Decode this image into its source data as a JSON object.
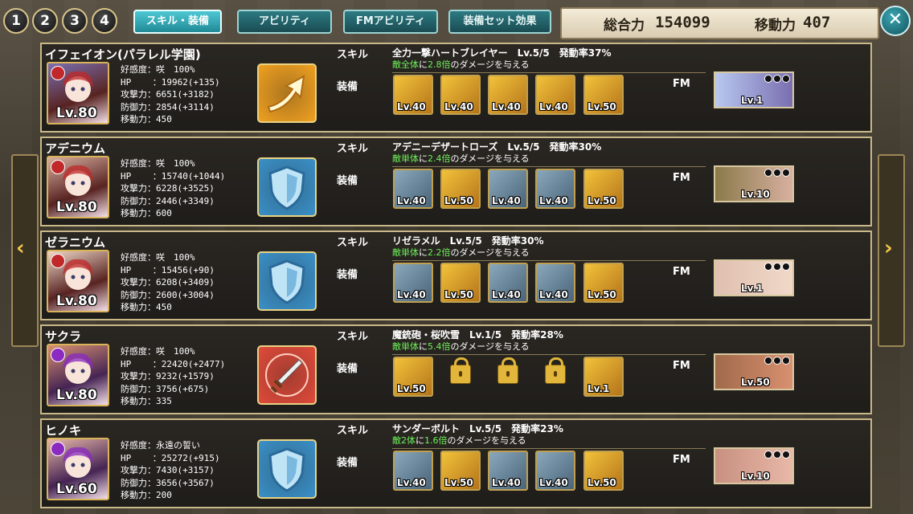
{
  "top_buttons": [
    "1",
    "2",
    "3",
    "4"
  ],
  "tabs": [
    {
      "label": "スキル・装備",
      "active": true
    },
    {
      "label": "アビリティ",
      "active": false
    },
    {
      "label": "FMアビリティ",
      "active": false
    },
    {
      "label": "装備セット効果",
      "active": false
    }
  ],
  "power": {
    "total_label": "総合力",
    "total_value": "154099",
    "move_label": "移動力",
    "move_value": "407"
  },
  "close_label": "✕",
  "arrows": {
    "left": "‹",
    "right": "›"
  },
  "labels": {
    "skill": "スキル",
    "equip": "装備",
    "fm": "FM"
  },
  "stat_keys": {
    "affection": "好感度",
    "hp": "HP",
    "atk": "攻撃力",
    "def": "防御力",
    "move": "移動力"
  },
  "characters": [
    {
      "name": "イフェイオン(パラレル学園)",
      "level": "Lv.80",
      "element_color": "#c0282a",
      "affection": "咲　100%",
      "hp": "19962(+135)",
      "atk": "6651(+3182)",
      "def": "2854(+3114)",
      "move": "450",
      "skill_icon": "arrow-up-icon",
      "skill_color": "#f0a020",
      "skill_name": "全力一撃ハートブレイヤー　Lv.5/5　発動率37%",
      "skill_target": "敵全体",
      "skill_mid": "に",
      "skill_mult": "2.8倍",
      "skill_tail": "のダメージを与える",
      "equipment": [
        {
          "lv": "Lv.40",
          "type": "gold"
        },
        {
          "lv": "Lv.40",
          "type": "gold"
        },
        {
          "lv": "Lv.40",
          "type": "gold"
        },
        {
          "lv": "Lv.40",
          "type": "gold"
        },
        {
          "lv": "Lv.50",
          "type": "gold"
        }
      ],
      "fm_level": "Lv.1",
      "fm_colors": [
        "#b8c8f0",
        "#7a6fb0"
      ]
    },
    {
      "name": "アデニウム",
      "level": "Lv.80",
      "element_color": "#c0282a",
      "affection": "咲　100%",
      "hp": "15740(+1044)",
      "atk": "6228(+3525)",
      "def": "2446(+3349)",
      "move": "600",
      "skill_icon": "shield-icon",
      "skill_color": "#3a90c8",
      "skill_name": "アデニーデザートローズ　Lv.5/5　発動率30%",
      "skill_target": "敵単体",
      "skill_mid": "に",
      "skill_mult": "2.4倍",
      "skill_tail": "のダメージを与える",
      "equipment": [
        {
          "lv": "Lv.40",
          "type": "silver"
        },
        {
          "lv": "Lv.50",
          "type": "gold"
        },
        {
          "lv": "Lv.40",
          "type": "silver"
        },
        {
          "lv": "Lv.40",
          "type": "silver"
        },
        {
          "lv": "Lv.50",
          "type": "gold"
        }
      ],
      "fm_level": "Lv.10",
      "fm_colors": [
        "#8a7a4a",
        "#d8b0a0"
      ]
    },
    {
      "name": "ゼラニウム",
      "level": "Lv.80",
      "element_color": "#c0282a",
      "affection": "咲　100%",
      "hp": "15456(+90)",
      "atk": "6208(+3409)",
      "def": "2600(+3004)",
      "move": "450",
      "skill_icon": "shield-icon",
      "skill_color": "#3a90c8",
      "skill_name": "リゼラメル　Lv.5/5　発動率30%",
      "skill_target": "敵単体",
      "skill_mid": "に",
      "skill_mult": "2.2倍",
      "skill_tail": "のダメージを与える",
      "equipment": [
        {
          "lv": "Lv.40",
          "type": "silver"
        },
        {
          "lv": "Lv.50",
          "type": "gold"
        },
        {
          "lv": "Lv.40",
          "type": "silver"
        },
        {
          "lv": "Lv.40",
          "type": "silver"
        },
        {
          "lv": "Lv.50",
          "type": "gold"
        }
      ],
      "fm_level": "Lv.1",
      "fm_colors": [
        "#e0c0b0",
        "#f0d8c8"
      ]
    },
    {
      "name": "サクラ",
      "level": "Lv.80",
      "element_color": "#8a2ac0",
      "affection": "咲　100%",
      "hp": "22420(+2477)",
      "atk": "9232(+1579)",
      "def": "3756(+675)",
      "move": "335",
      "skill_icon": "sword-icon",
      "skill_color": "#e04a3a",
      "skill_name": "魔銃砲・桜吹雪　Lv.1/5　発動率28%",
      "skill_target": "敵単体",
      "skill_mid": "に",
      "skill_mult": "5.4倍",
      "skill_tail": "のダメージを与える",
      "equipment": [
        {
          "lv": "Lv.50",
          "type": "gold"
        },
        {
          "lv": "",
          "type": "locked"
        },
        {
          "lv": "",
          "type": "locked"
        },
        {
          "lv": "",
          "type": "locked"
        },
        {
          "lv": "Lv.1",
          "type": "gold"
        }
      ],
      "fm_level": "Lv.50",
      "fm_colors": [
        "#a06a4a",
        "#d89070"
      ]
    },
    {
      "name": "ヒノキ",
      "level": "Lv.60",
      "element_color": "#8a2ac0",
      "affection": "永遠の誓い",
      "hp": "25272(+915)",
      "atk": "7430(+3157)",
      "def": "3656(+3567)",
      "move": "200",
      "skill_icon": "shield-icon",
      "skill_color": "#3a90c8",
      "skill_name": "サンダーボルト　Lv.5/5　発動率23%",
      "skill_target": "敵2体",
      "skill_mid": "に",
      "skill_mult": "1.6倍",
      "skill_tail": "のダメージを与える",
      "equipment": [
        {
          "lv": "Lv.40",
          "type": "silver"
        },
        {
          "lv": "Lv.50",
          "type": "gold"
        },
        {
          "lv": "Lv.40",
          "type": "silver"
        },
        {
          "lv": "Lv.40",
          "type": "silver"
        },
        {
          "lv": "Lv.50",
          "type": "gold"
        }
      ],
      "fm_level": "Lv.10",
      "fm_colors": [
        "#c89080",
        "#e8b8a8"
      ]
    }
  ]
}
